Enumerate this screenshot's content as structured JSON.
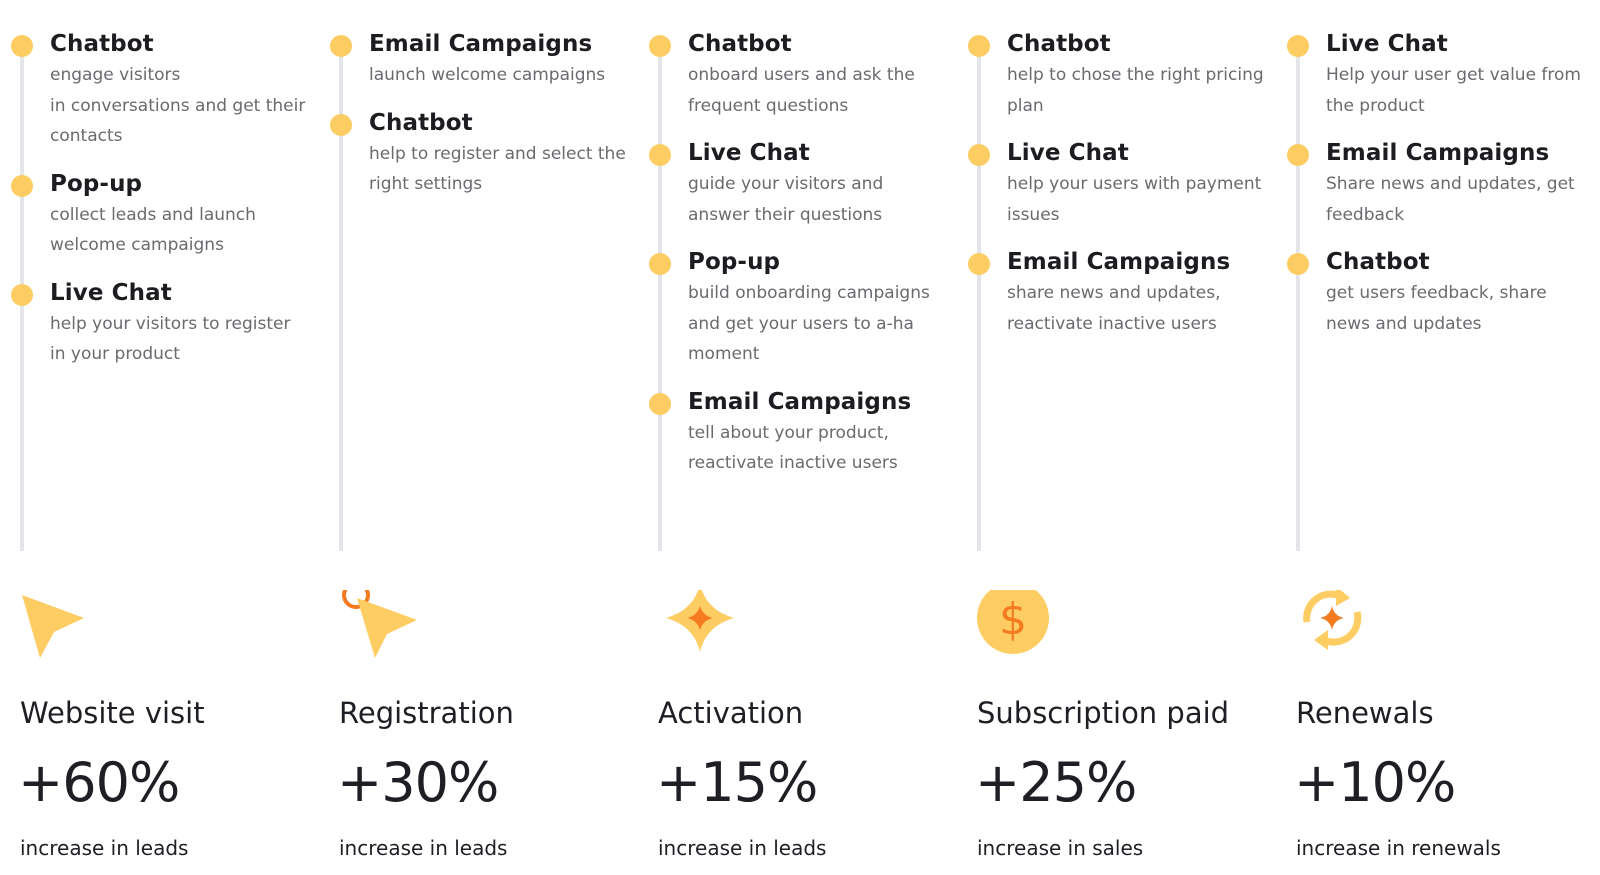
{
  "colors": {
    "dot": "#fdcd63",
    "icon_primary": "#fdcd63",
    "icon_accent": "#f47b20",
    "timeline": "#e3e5e9"
  },
  "columns": [
    {
      "stage": "Website visit",
      "metric": "+60%",
      "metric_label": "increase in leads",
      "icon": "cursor-icon",
      "steps": [
        {
          "title": "Chatbot",
          "desc": "engage visitors\nin conversations and get their contacts"
        },
        {
          "title": "Pop-up",
          "desc": "collect leads and launch welcome campaigns"
        },
        {
          "title": "Live Chat",
          "desc": "help your visitors to register in your product"
        }
      ]
    },
    {
      "stage": "Registration",
      "metric": "+30%",
      "metric_label": "increase in leads",
      "icon": "cursor-click-icon",
      "steps": [
        {
          "title": "Email Campaigns",
          "desc": "launch welcome campaigns"
        },
        {
          "title": "Chatbot",
          "desc": "help to register and select the right settings"
        }
      ]
    },
    {
      "stage": "Activation",
      "metric": "+15%",
      "metric_label": "increase in leads",
      "icon": "sparkle-icon",
      "steps": [
        {
          "title": "Chatbot",
          "desc": "onboard users and ask the frequent questions"
        },
        {
          "title": "Live Chat",
          "desc": "guide your visitors and answer their questions"
        },
        {
          "title": "Pop-up",
          "desc": "build onboarding campaigns and get your users to a-ha moment"
        },
        {
          "title": "Email Campaigns",
          "desc": "tell about your product, reactivate inactive users"
        }
      ]
    },
    {
      "stage": "Subscription paid",
      "metric": "+25%",
      "metric_label": "increase in sales",
      "icon": "dollar-coin-icon",
      "steps": [
        {
          "title": "Chatbot",
          "desc": "help to chose the right pricing plan"
        },
        {
          "title": "Live Chat",
          "desc": "help your users with payment issues"
        },
        {
          "title": "Email Campaigns",
          "desc": "share news and updates, reactivate inactive users"
        }
      ]
    },
    {
      "stage": "Renewals",
      "metric": "+10%",
      "metric_label": "increase in renewals",
      "icon": "refresh-sparkle-icon",
      "steps": [
        {
          "title": "Live Chat",
          "desc": "Help your user get value from the product"
        },
        {
          "title": "Email Campaigns",
          "desc": "Share news and updates, get feedback"
        },
        {
          "title": "Chatbot",
          "desc": "get users feedback, share news and updates"
        }
      ]
    }
  ]
}
